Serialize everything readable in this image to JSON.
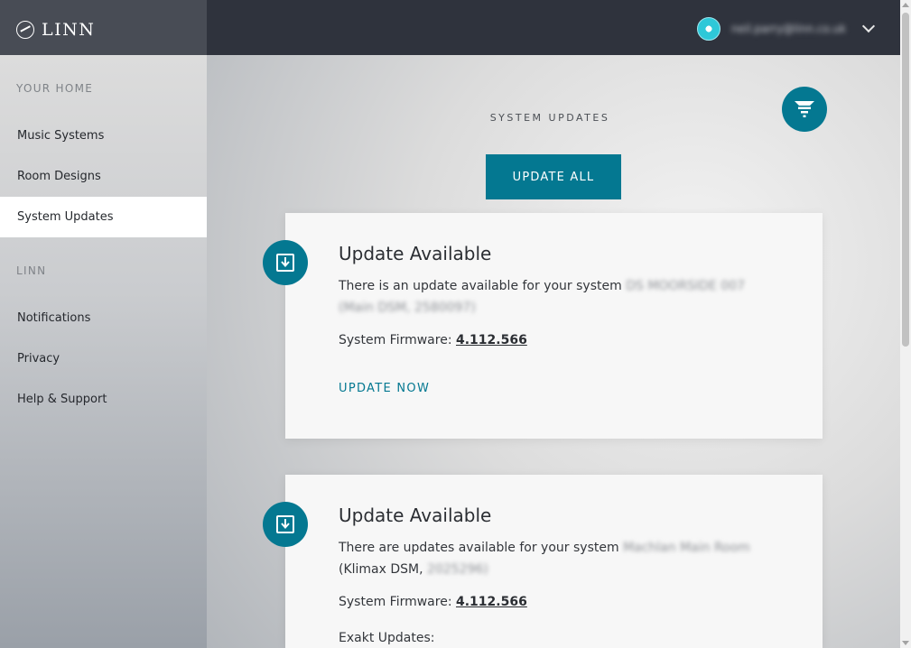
{
  "brand": {
    "name": "LINN"
  },
  "account": {
    "email": "neil.parry@linn.co.uk"
  },
  "sidebar": {
    "sections": [
      {
        "title": "YOUR HOME",
        "items": [
          {
            "label": "Music Systems"
          },
          {
            "label": "Room Designs"
          },
          {
            "label": "System Updates",
            "active": true
          }
        ]
      },
      {
        "title": "LINN",
        "items": [
          {
            "label": "Notifications"
          },
          {
            "label": "Privacy"
          },
          {
            "label": "Help & Support"
          }
        ]
      }
    ]
  },
  "main": {
    "title": "SYSTEM UPDATES",
    "update_all_label": "UPDATE ALL",
    "cards": [
      {
        "title": "Update Available",
        "desc_prefix": "There is an update available for your system",
        "system_name_blurred": "DS MOORSIDE 007 (Main DSM, 2580097)",
        "firmware_label": "System Firmware:",
        "firmware_version": "4.112.566",
        "action_label": "UPDATE NOW"
      },
      {
        "title": "Update Available",
        "desc_prefix": "There are updates available for your system",
        "system_name_blurred": "Machlan Main Room",
        "desc_paren_prefix": "(Klimax DSM,",
        "desc_paren_blurred": "2025296)",
        "firmware_label": "System Firmware:",
        "firmware_version": "4.112.566",
        "exakt_label": "Exakt Updates:"
      }
    ]
  },
  "colors": {
    "accent": "#047891",
    "topbar": "#2f333d",
    "brand_bg": "#484c55"
  },
  "icons": {
    "filter": "filter-icon",
    "download": "download-icon",
    "chevron": "chevron-down-icon"
  }
}
